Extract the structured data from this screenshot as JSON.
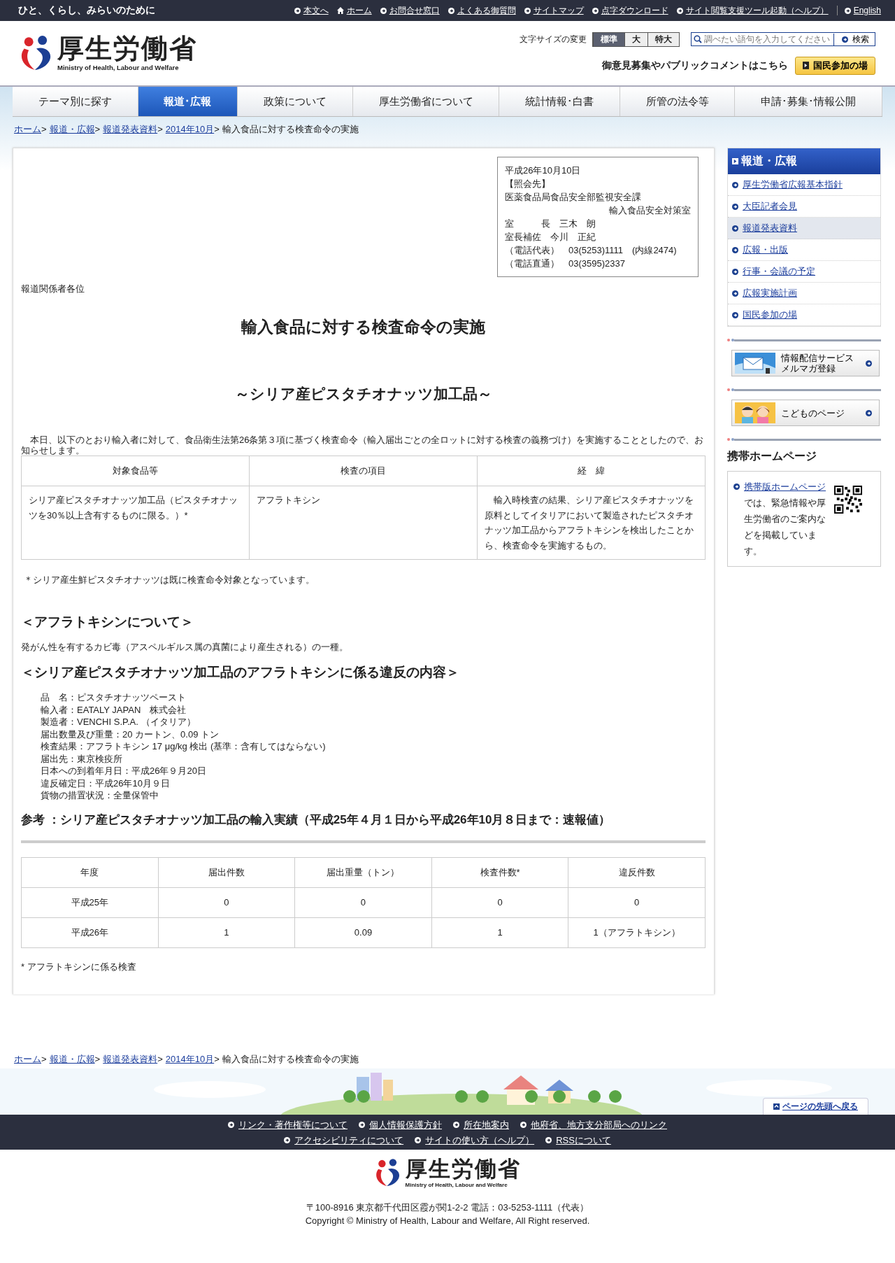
{
  "top_bar": {
    "tagline": "ひと、くらし、みらいのために",
    "links": [
      {
        "label": "本文へ",
        "kind": "arrow"
      },
      {
        "label": "ホーム",
        "kind": "home"
      },
      {
        "label": "お問合せ窓口",
        "kind": "arrow"
      },
      {
        "label": "よくある御質問",
        "kind": "arrow"
      },
      {
        "label": "サイトマップ",
        "kind": "arrow"
      },
      {
        "label": "点字ダウンロード",
        "kind": "arrow"
      },
      {
        "label": "サイト閲覧支援ツール起動（ヘルプ）",
        "kind": "arrow"
      },
      {
        "label": "English",
        "kind": "separated"
      }
    ]
  },
  "header": {
    "logo": {
      "name": "厚生労働省",
      "subtitle": "Ministry of Health, Labour and Welfare"
    },
    "font_size": {
      "label": "文字サイズの変更",
      "options": [
        {
          "label": "標準",
          "selected": true
        },
        {
          "label": "大",
          "selected": false
        },
        {
          "label": "特大",
          "selected": false
        }
      ]
    },
    "search": {
      "placeholder": "調べたい語句を入力してください",
      "button": "検索"
    },
    "public_comment": {
      "text": "御意見募集やパブリックコメントはこちら",
      "button": "国民参加の場"
    }
  },
  "nav": [
    {
      "label": "テーマ別に探す",
      "selected": false
    },
    {
      "label": "報道･広報",
      "selected": true
    },
    {
      "label": "政策について",
      "selected": false
    },
    {
      "label": "厚生労働省について",
      "selected": false
    },
    {
      "label": "統計情報･白書",
      "selected": false
    },
    {
      "label": "所管の法令等",
      "selected": false
    },
    {
      "label": "申請･募集･情報公開",
      "selected": false
    }
  ],
  "breadcrumb": [
    {
      "label": "ホーム",
      "link": true,
      "separator": ">"
    },
    {
      "label": "報道・広報",
      "link": true,
      "separator": ">"
    },
    {
      "label": "報道発表資料",
      "link": true,
      "separator": ">"
    },
    {
      "label": "2014年10月",
      "link": true,
      "separator": ">"
    },
    {
      "label": "輸入食品に対する検査命令の実施",
      "link": false
    }
  ],
  "notice": {
    "lines": [
      {
        "text": "平成26年10月10日",
        "kind": "left"
      },
      {
        "text": "【照会先】",
        "kind": "left"
      },
      {
        "text": "医薬食品局食品安全部監視安全課",
        "kind": "left"
      },
      {
        "text": "輸入食品安全対策室",
        "kind": "right"
      },
      {
        "text": "室　　　長　三木　朗",
        "kind": "left"
      },
      {
        "text": "室長補佐　今川　正紀",
        "kind": "left"
      },
      {
        "text": "（電話代表）　03(5253)1111　(内線2474)",
        "kind": "left"
      },
      {
        "text": "（電話直通）　03(3595)2337",
        "kind": "left"
      }
    ]
  },
  "recipient": "報道関係者各位",
  "title": "輸入食品に対する検査命令の実施",
  "subtitle": "～シリア産ピスタチオナッツ加工品～",
  "intro": "　本日、以下のとおり輸入者に対して、食品衛生法第26条第３項に基づく検査命令（輸入届出ごとの全ロットに対する検査の義務づけ）を実施することとしたので、お知らせします。",
  "order_table": {
    "columns": [
      "対象食品等",
      "検査の項目",
      "経　緯"
    ],
    "rows": [
      [
        "シリア産ピスタチオナッツ加工品（ピスタチオナッツを30％以上含有するものに限る。）*",
        "アフラトキシン",
        "　輸入時検査の結果、シリア産ピスタチオナッツを原料としてイタリアにおいて製造されたピスタチオナッツ加工品からアフラトキシンを検出したことから、検査命令を実施するもの。"
      ]
    ]
  },
  "order_note": "＊シリア産生鮮ピスタチオナッツは既に検査命令対象となっています。",
  "aflatoxin": {
    "heading": "＜アフラトキシンについて＞",
    "text": "発がん性を有するカビ毒（アスペルギルス属の真菌により産生される）の一種。"
  },
  "violation": {
    "heading": "＜シリア産ピスタチオナッツ加工品のアフラトキシンに係る違反の内容＞",
    "lines": [
      "品　名：ピスタチオナッツペースト",
      "輸入者：EATALY JAPAN　株式会社",
      "製造者：VENCHI S.P.A. （イタリア）",
      "届出数量及び重量：20 カートン、0.09 トン",
      "検査結果：アフラトキシン 17 μg/kg 検出 (基準：含有してはならない)",
      "届出先：東京検疫所",
      "日本への到着年月日：平成26年９月20日",
      "違反確定日：平成26年10月９日",
      "貨物の措置状況：全量保管中"
    ]
  },
  "imports": {
    "heading": "参考 ：シリア産ピスタチオナッツ加工品の輸入実績（平成25年４月１日から平成26年10月８日まで：速報値）",
    "columns": [
      "年度",
      "届出件数",
      "届出重量（トン）",
      "検査件数*",
      "違反件数"
    ],
    "rows": [
      [
        "平成25年",
        "0",
        "0",
        "0",
        "0"
      ],
      [
        "平成26年",
        "1",
        "0.09",
        "1",
        "1（アフラトキシン）"
      ]
    ],
    "note": "* アフラトキシンに係る検査"
  },
  "sidebar": {
    "heading": "報道・広報",
    "items": [
      {
        "label": "厚生労働省広報基本指針",
        "selected": false
      },
      {
        "label": "大臣記者会見",
        "selected": false
      },
      {
        "label": "報道発表資料",
        "selected": true
      },
      {
        "label": "広報・出版",
        "selected": false
      },
      {
        "label": "行事・会議の予定",
        "selected": false
      },
      {
        "label": "広報実施計画",
        "selected": false
      },
      {
        "label": "国民参加の場",
        "selected": false
      }
    ],
    "banners": [
      {
        "kind": "mail",
        "lines": [
          "情報配信サービス",
          "メルマガ登録"
        ]
      },
      {
        "kind": "kids",
        "lines": [
          "こどものページ"
        ]
      }
    ],
    "mobile": {
      "heading": "携帯ホームページ",
      "link": "携帯版ホームページ",
      "text": "では、緊急情報や厚生労働省のご案内などを掲載しています。"
    }
  },
  "footer": {
    "breadcrumb": [
      {
        "label": "ホーム",
        "link": true,
        "separator": ">"
      },
      {
        "label": "報道・広報",
        "link": true,
        "separator": ">"
      },
      {
        "label": "報道発表資料",
        "link": true,
        "separator": ">"
      },
      {
        "label": "2014年10月",
        "link": true,
        "separator": ">"
      },
      {
        "label": "輸入食品に対する検査命令の実施",
        "link": false
      }
    ],
    "back_to_top": "ページの先頭へ戻る",
    "link_rows": [
      [
        "リンク・著作権等について",
        "個人情報保護方針",
        "所在地案内",
        "他府省、地方支分部局へのリンク"
      ],
      [
        "アクセシビリティについて",
        "サイトの使い方（ヘルプ）",
        "RSSについて"
      ]
    ],
    "logo": {
      "name": "厚生労働省",
      "subtitle": "Ministry of Health, Labour and Welfare"
    },
    "address": "〒100-8916 東京都千代田区霞が関1-2-2 電話：03-5253-1111（代表）",
    "copyright": "Copyright © Ministry of Health, Labour and Welfare, All Right reserved."
  }
}
